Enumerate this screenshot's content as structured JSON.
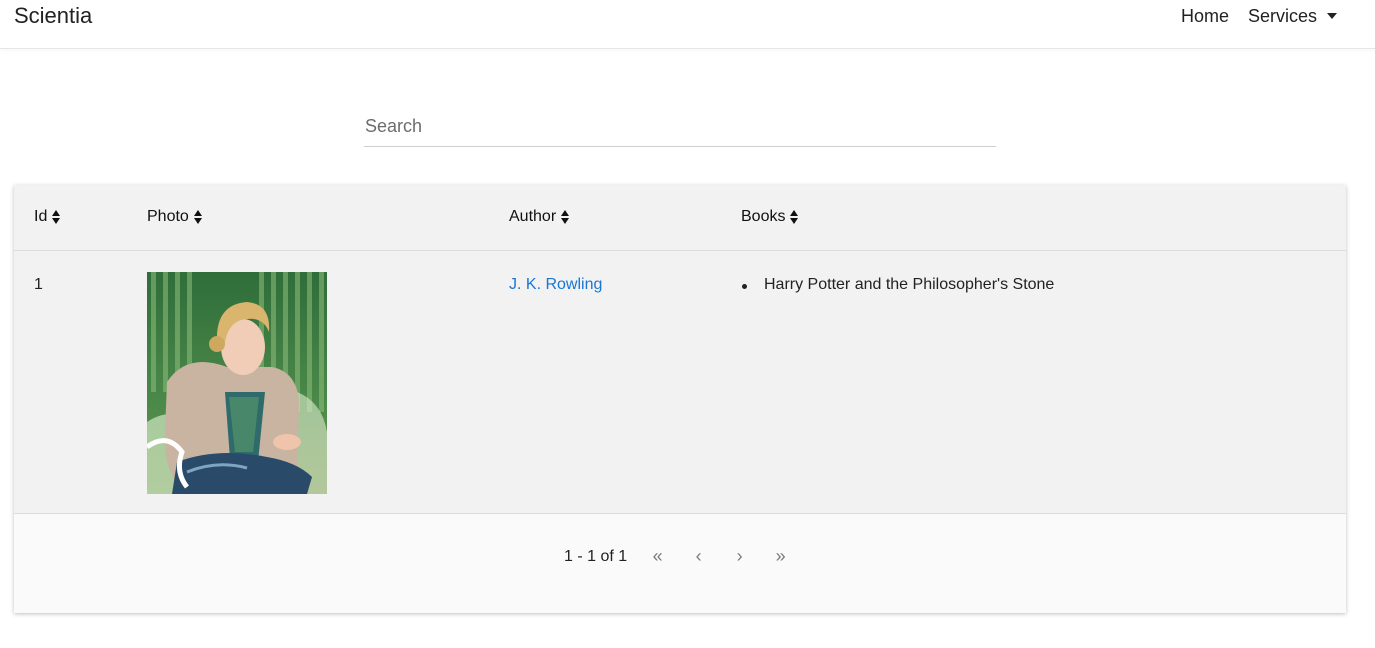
{
  "navbar": {
    "brand": "Scientia",
    "links": [
      {
        "label": "Home"
      },
      {
        "label": "Services"
      }
    ]
  },
  "search": {
    "placeholder": "Search",
    "value": ""
  },
  "table": {
    "columns": [
      "Id",
      "Photo",
      "Author",
      "Books"
    ],
    "rows": [
      {
        "id": "1",
        "photo": "author-photo",
        "author": "J. K. Rowling",
        "books": [
          "Harry Potter and the Philosopher's Stone"
        ]
      }
    ]
  },
  "pagination": {
    "range": "1 - 1 of 1",
    "first": "«",
    "prev": "‹",
    "next": "›",
    "last": "»"
  },
  "colors": {
    "link": "#1976d2",
    "card_bg": "#f2f2f2",
    "footer_bg": "#fafafa"
  }
}
